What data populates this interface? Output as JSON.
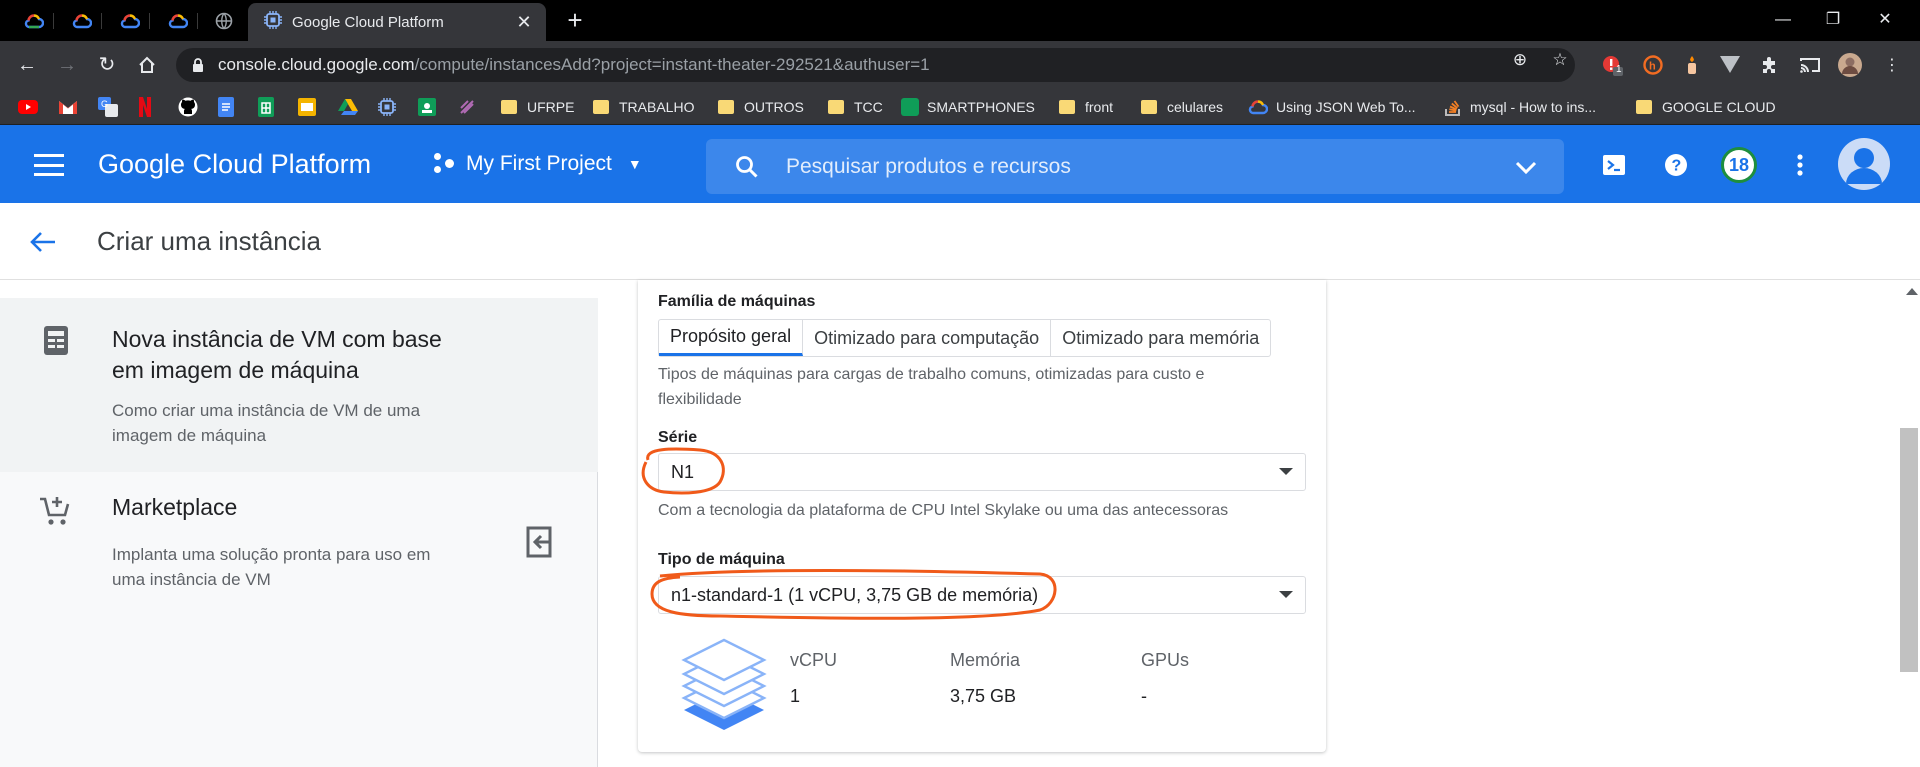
{
  "browser": {
    "active_tab_title": "Google Cloud Platform",
    "url_host": "console.cloud.google.com",
    "url_path": "/compute/instancesAdd?project=instant-theater-292521&authuser=1",
    "extension_badge": "1"
  },
  "bookmarks": [
    {
      "label": "UFRPE",
      "type": "folder"
    },
    {
      "label": "TRABALHO",
      "type": "folder"
    },
    {
      "label": "OUTROS",
      "type": "folder"
    },
    {
      "label": "TCC",
      "type": "folder"
    },
    {
      "label": "SMARTPHONES",
      "type": "sheets"
    },
    {
      "label": "front",
      "type": "folder"
    },
    {
      "label": "celulares",
      "type": "folder"
    },
    {
      "label": "Using JSON Web To...",
      "type": "gcloud"
    },
    {
      "label": "mysql - How to ins...",
      "type": "stackoverflow"
    },
    {
      "label": "GOOGLE CLOUD",
      "type": "folder"
    }
  ],
  "header": {
    "title": "Google Cloud Platform",
    "project": "My First Project",
    "search_placeholder": "Pesquisar produtos e recursos",
    "notification_count": "18"
  },
  "page": {
    "title": "Criar uma instância"
  },
  "sidebar": {
    "items": [
      {
        "title_line1": "Nova instância de VM com base",
        "title_line2": "em imagem de máquina",
        "desc_line1": "Como criar uma instância de VM de uma",
        "desc_line2": "imagem de máquina"
      },
      {
        "title_line1": "Marketplace",
        "desc_line1": "Implanta uma solução pronta para uso em",
        "desc_line2": "uma instância de VM"
      }
    ]
  },
  "form": {
    "family_label": "Família de máquinas",
    "family_tabs": [
      "Propósito geral",
      "Otimizado para computação",
      "Otimizado para memória"
    ],
    "family_selected": "Propósito geral",
    "family_help_line1": "Tipos de máquinas para cargas de trabalho comuns, otimizadas para custo e",
    "family_help_line2": "flexibilidade",
    "series_label": "Série",
    "series_value": "N1",
    "series_help": "Com a tecnologia da plataforma de CPU Intel Skylake ou uma das antecessoras",
    "machine_type_label": "Tipo de máquina",
    "machine_type_value": "n1-standard-1 (1 vCPU, 3,75 GB de memória)",
    "specs": {
      "vcpu_label": "vCPU",
      "vcpu_value": "1",
      "memory_label": "Memória",
      "memory_value": "3,75 GB",
      "gpu_label": "GPUs",
      "gpu_value": "-"
    }
  },
  "colors": {
    "gcp_blue": "#1a73e8",
    "annotation_orange": "#f05a1a"
  }
}
